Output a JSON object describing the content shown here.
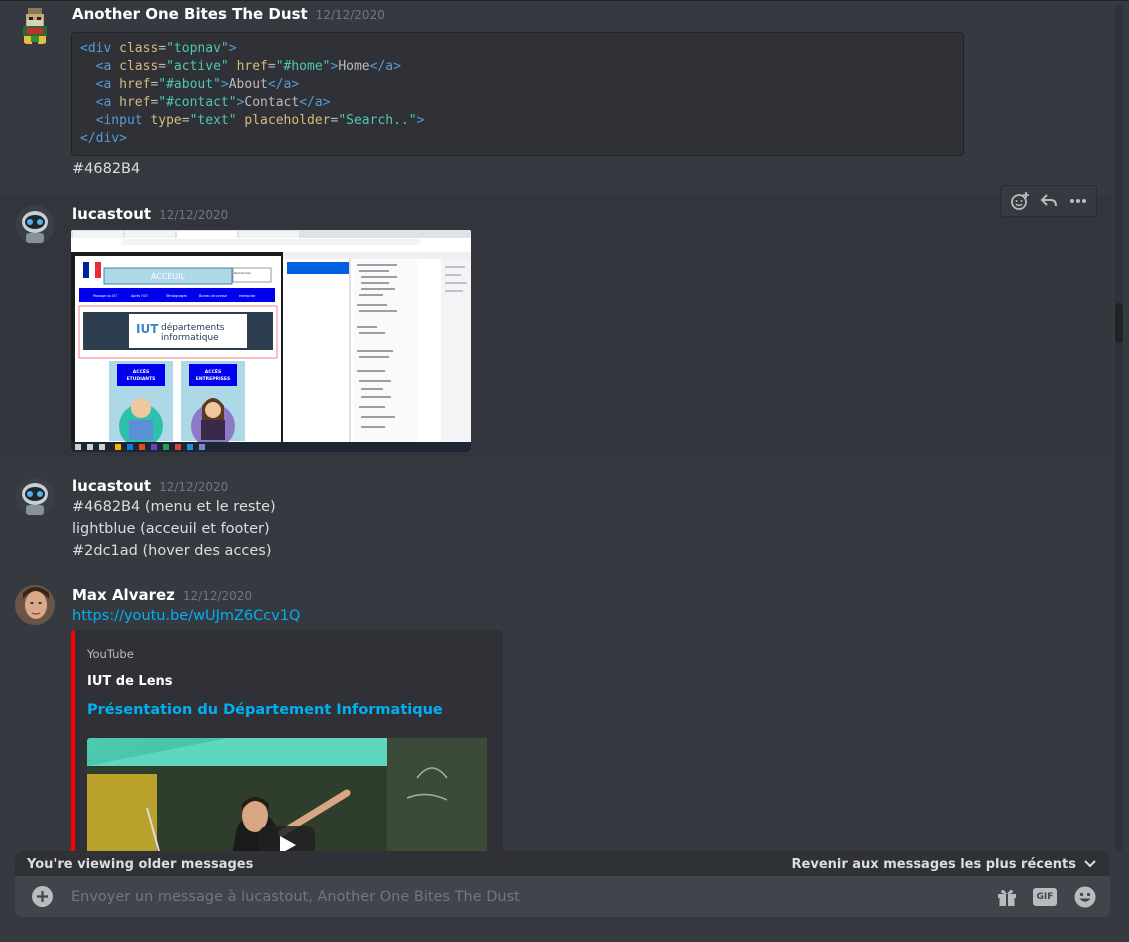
{
  "messages": [
    {
      "username": "Another One Bites The Dust",
      "timestamp": "12/12/2020",
      "code": [
        [
          [
            "tag",
            "<div"
          ],
          [
            "pun",
            " "
          ],
          [
            "attr",
            "class"
          ],
          [
            "pun",
            "="
          ],
          [
            "str",
            "\"topnav\""
          ],
          [
            "tag",
            ">"
          ]
        ],
        [
          [
            "pun",
            "  "
          ],
          [
            "tag",
            "<a"
          ],
          [
            "pun",
            " "
          ],
          [
            "attr",
            "class"
          ],
          [
            "pun",
            "="
          ],
          [
            "str",
            "\"active\""
          ],
          [
            "pun",
            " "
          ],
          [
            "attr",
            "href"
          ],
          [
            "pun",
            "="
          ],
          [
            "str",
            "\"#home\""
          ],
          [
            "tag",
            ">"
          ],
          [
            "pun",
            "Home"
          ],
          [
            "tag",
            "</a"
          ],
          [
            "tag",
            ">"
          ]
        ],
        [
          [
            "pun",
            "  "
          ],
          [
            "tag",
            "<a"
          ],
          [
            "pun",
            " "
          ],
          [
            "attr",
            "href"
          ],
          [
            "pun",
            "="
          ],
          [
            "str",
            "\"#about\""
          ],
          [
            "tag",
            ">"
          ],
          [
            "pun",
            "About"
          ],
          [
            "tag",
            "</a"
          ],
          [
            "tag",
            ">"
          ]
        ],
        [
          [
            "pun",
            "  "
          ],
          [
            "tag",
            "<a"
          ],
          [
            "pun",
            " "
          ],
          [
            "attr",
            "href"
          ],
          [
            "pun",
            "="
          ],
          [
            "str",
            "\"#contact\""
          ],
          [
            "tag",
            ">"
          ],
          [
            "pun",
            "Contact"
          ],
          [
            "tag",
            "</a"
          ],
          [
            "tag",
            ">"
          ]
        ],
        [
          [
            "pun",
            "  "
          ],
          [
            "tag",
            "<input"
          ],
          [
            "pun",
            " "
          ],
          [
            "attr",
            "type"
          ],
          [
            "pun",
            "="
          ],
          [
            "str",
            "\"text\""
          ],
          [
            "pun",
            " "
          ],
          [
            "attr",
            "placeholder"
          ],
          [
            "pun",
            "="
          ],
          [
            "str",
            "\"Search..\""
          ],
          [
            "tag",
            ">"
          ]
        ],
        [
          [
            "tag",
            "</div"
          ],
          [
            "tag",
            ">"
          ]
        ]
      ],
      "text": "#4682B4"
    },
    {
      "username": "lucastout",
      "timestamp": "12/12/2020"
    },
    {
      "username": "lucastout",
      "timestamp": "12/12/2020",
      "lines": [
        "#4682B4 (menu et le reste)",
        "lightblue (acceuil et footer)",
        "#2dc1ad (hover des acces)"
      ]
    },
    {
      "username": "Max Alvarez",
      "timestamp": "12/12/2020",
      "link": "https://youtu.be/wUJmZ6Ccv1Q",
      "embed": {
        "provider": "YouTube",
        "author": "IUT de Lens",
        "title": "Présentation du Département Informatique"
      }
    }
  ],
  "screenshot": {
    "nav_items": [
      "Passage au IUT",
      "Après l'IUT",
      "Témoignages",
      "Bureau de presse",
      "entreprise"
    ],
    "banner_title": "ACCEUIL",
    "search_label": "Rechercher",
    "logo_text_1": "départements",
    "logo_text_2": "informatique",
    "card_left": [
      "ACCÈS",
      "ETUDIANTS"
    ],
    "card_right": [
      "ACCÈS",
      "ENTREPRISES"
    ]
  },
  "older_bar": {
    "left_text": "You're viewing older messages",
    "right_text": "Revenir aux messages les plus récents"
  },
  "composer": {
    "placeholder": "Envoyer un message à lucastout, Another One Bites The Dust",
    "gif_label": "GIF"
  },
  "colors": {
    "background": "#36393f",
    "link": "#00b0f4",
    "embed_border": "#ff0000"
  }
}
